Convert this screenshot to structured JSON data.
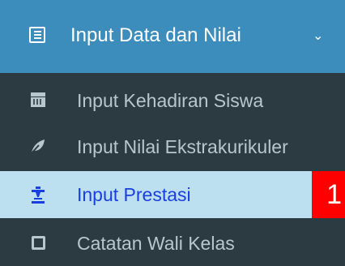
{
  "menu": {
    "header": {
      "label": "Input Data dan Nilai",
      "icon": "list-alt-icon",
      "chevron": "chevron-down-icon"
    },
    "items": [
      {
        "label": "Input Kehadiran Siswa",
        "icon": "calendar-icon"
      },
      {
        "label": "Input Nilai Ekstrakurikuler",
        "icon": "leaf-icon"
      },
      {
        "label": "Input Prestasi",
        "icon": "trophy-icon",
        "active": true
      },
      {
        "label": "Catatan Wali Kelas",
        "icon": "edit-icon"
      }
    ]
  },
  "badge": "1",
  "colors": {
    "header_bg": "#3c8dbc",
    "submenu_bg": "#2c3b41",
    "active_bg": "#bde0f0",
    "active_text": "#1a3fe0",
    "badge_bg": "#ff0000"
  }
}
